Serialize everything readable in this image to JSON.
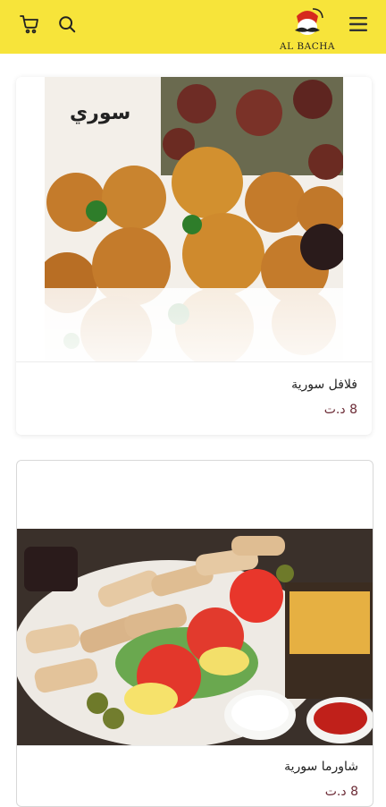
{
  "header": {
    "brand": "AL BACHA",
    "icons": [
      "cart-icon",
      "search-icon",
      "menu-icon"
    ],
    "background": "#f7e43a"
  },
  "products": [
    {
      "name": "فلافل سورية",
      "price": "8 د.ت",
      "overlay_text": "سوري"
    },
    {
      "name": "شاورما سورية",
      "price": "8 د.ت"
    }
  ],
  "colors": {
    "price": "#6b2a35",
    "text": "#222222"
  }
}
